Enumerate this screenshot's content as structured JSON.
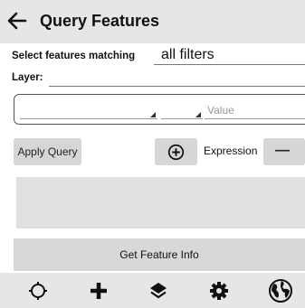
{
  "header": {
    "title": "Query Features",
    "back_icon": "back-arrow-icon"
  },
  "query": {
    "match_label": "Select features matching",
    "match_value": "all filters",
    "layer_label": "Layer:",
    "layer_value": "",
    "filter": {
      "field_value": "",
      "operator_value": "",
      "value_placeholder": "Value"
    }
  },
  "actions": {
    "apply_label": "Apply Query",
    "expression_label": "Expression",
    "add_icon": "plus-circle-icon",
    "remove_label": "—"
  },
  "get_info_label": "Get Feature Info",
  "toolbar": {
    "items": [
      {
        "icon": "crosshair-icon"
      },
      {
        "icon": "plus-icon"
      },
      {
        "icon": "layers-icon"
      },
      {
        "icon": "gear-icon"
      },
      {
        "icon": "globe-icon"
      }
    ]
  }
}
